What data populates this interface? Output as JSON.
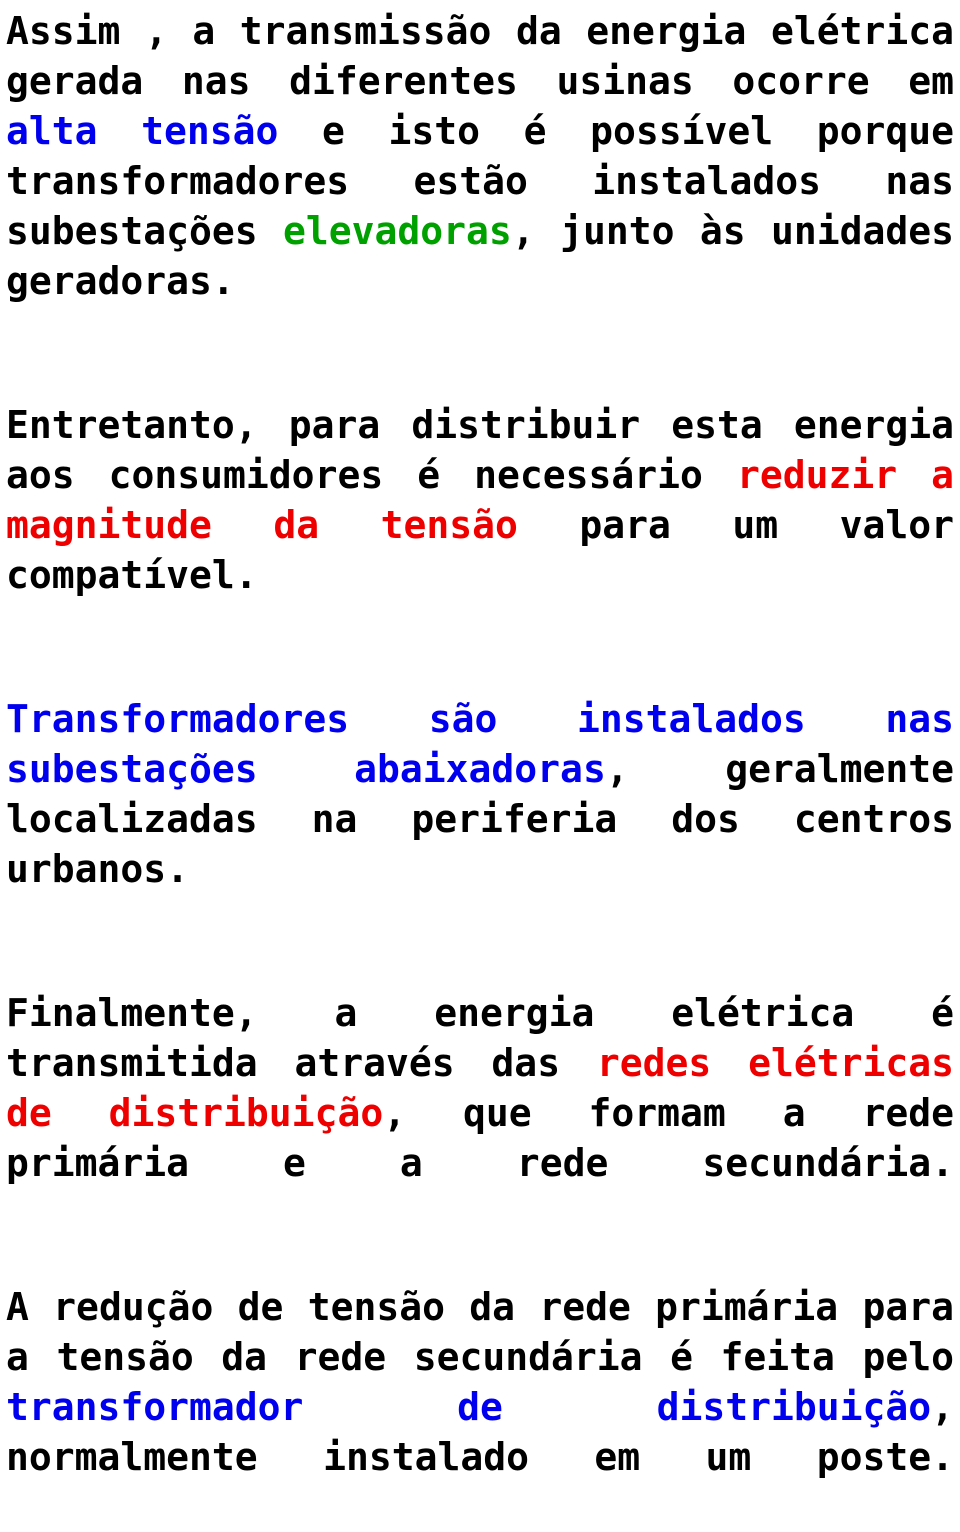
{
  "document": {
    "paragraphs": [
      {
        "id": "p1",
        "runs": [
          {
            "text": "Assim , a transmissão da energia elétrica gerada nas diferentes usinas ocorre em ",
            "color": "black"
          },
          {
            "text": "alta tensão",
            "color": "blue"
          },
          {
            "text": " e isto é possível porque transformadores estão instalados nas subestações ",
            "color": "black"
          },
          {
            "text": "elevadoras",
            "color": "green"
          },
          {
            "text": ", junto às unidades geradoras.",
            "color": "black"
          }
        ]
      },
      {
        "id": "p2",
        "runs": [
          {
            "text": "Entretanto, para distribuir esta energia aos consumidores é necessário ",
            "color": "black"
          },
          {
            "text": "reduzir a magnitude da tensão",
            "color": "red"
          },
          {
            "text": " para um valor compatível.",
            "color": "black"
          }
        ]
      },
      {
        "id": "p3",
        "runs": [
          {
            "text": "Transformadores são instalados nas subestações abaixadoras",
            "color": "blue"
          },
          {
            "text": ", geralmente localizadas na periferia dos centros urbanos.",
            "color": "black"
          }
        ]
      },
      {
        "id": "p4",
        "runs": [
          {
            "text": "Finalmente, a energia elétrica é transmitida através das ",
            "color": "black"
          },
          {
            "text": "redes elétricas de distribuição",
            "color": "red"
          },
          {
            "text": ", que formam a rede primária e a rede secundária.",
            "color": "black"
          }
        ]
      },
      {
        "id": "p5",
        "runs": [
          {
            "text": "A redução de tensão da rede primária para a tensão da rede secundária é feita pelo ",
            "color": "black"
          },
          {
            "text": "transformador de distribuição",
            "color": "blue"
          },
          {
            "text": ", normalmente instalado em um poste.",
            "color": "black"
          }
        ]
      }
    ],
    "colors": {
      "black": "#000000",
      "blue": "#0000ee",
      "red": "#ee0000",
      "green": "#00a000"
    }
  }
}
